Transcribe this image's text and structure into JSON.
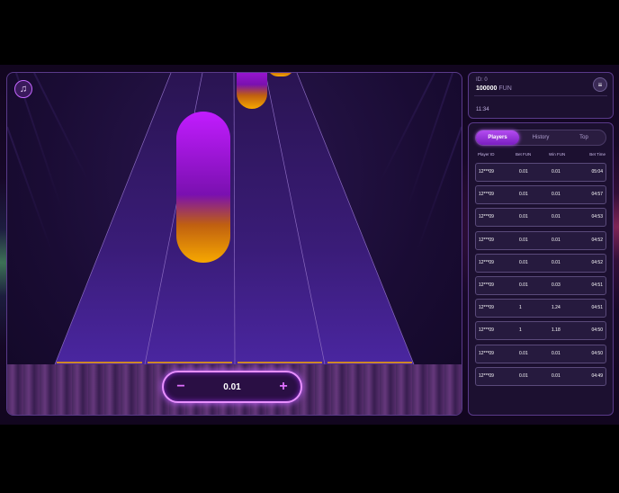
{
  "colors": {
    "accent": "#c466ff",
    "lane_glow": "#f7a800",
    "note_top": "#c21cff",
    "panel_border": "#5a3a8a"
  },
  "game": {
    "music_icon": "music-note-icon",
    "bet": {
      "minus": "−",
      "value": "0.01",
      "plus": "+"
    }
  },
  "account": {
    "id": "ID: 0",
    "balance": "100000",
    "currency": "FUN",
    "time": "11:34",
    "menu_icon": "hamburger-menu-icon"
  },
  "players": {
    "tabs": [
      {
        "label": "Players",
        "active": true
      },
      {
        "label": "History",
        "active": false
      },
      {
        "label": "Top",
        "active": false
      }
    ],
    "columns": [
      "Player ID",
      "Bet FUN",
      "Win FUN",
      "Bet Time"
    ],
    "rows": [
      {
        "id": "12***09",
        "bet": "0.01",
        "win": "0.01",
        "time": "05:04"
      },
      {
        "id": "12***09",
        "bet": "0.01",
        "win": "0.01",
        "time": "04:57"
      },
      {
        "id": "12***09",
        "bet": "0.01",
        "win": "0.01",
        "time": "04:53"
      },
      {
        "id": "12***09",
        "bet": "0.01",
        "win": "0.01",
        "time": "04:52"
      },
      {
        "id": "12***09",
        "bet": "0.01",
        "win": "0.01",
        "time": "04:52"
      },
      {
        "id": "12***09",
        "bet": "0.01",
        "win": "0.03",
        "time": "04:51"
      },
      {
        "id": "12***09",
        "bet": "1",
        "win": "1.24",
        "time": "04:51"
      },
      {
        "id": "12***09",
        "bet": "1",
        "win": "1.18",
        "time": "04:50"
      },
      {
        "id": "12***09",
        "bet": "0.01",
        "win": "0.01",
        "time": "04:50"
      },
      {
        "id": "12***09",
        "bet": "0.01",
        "win": "0.01",
        "time": "04:49"
      }
    ]
  }
}
